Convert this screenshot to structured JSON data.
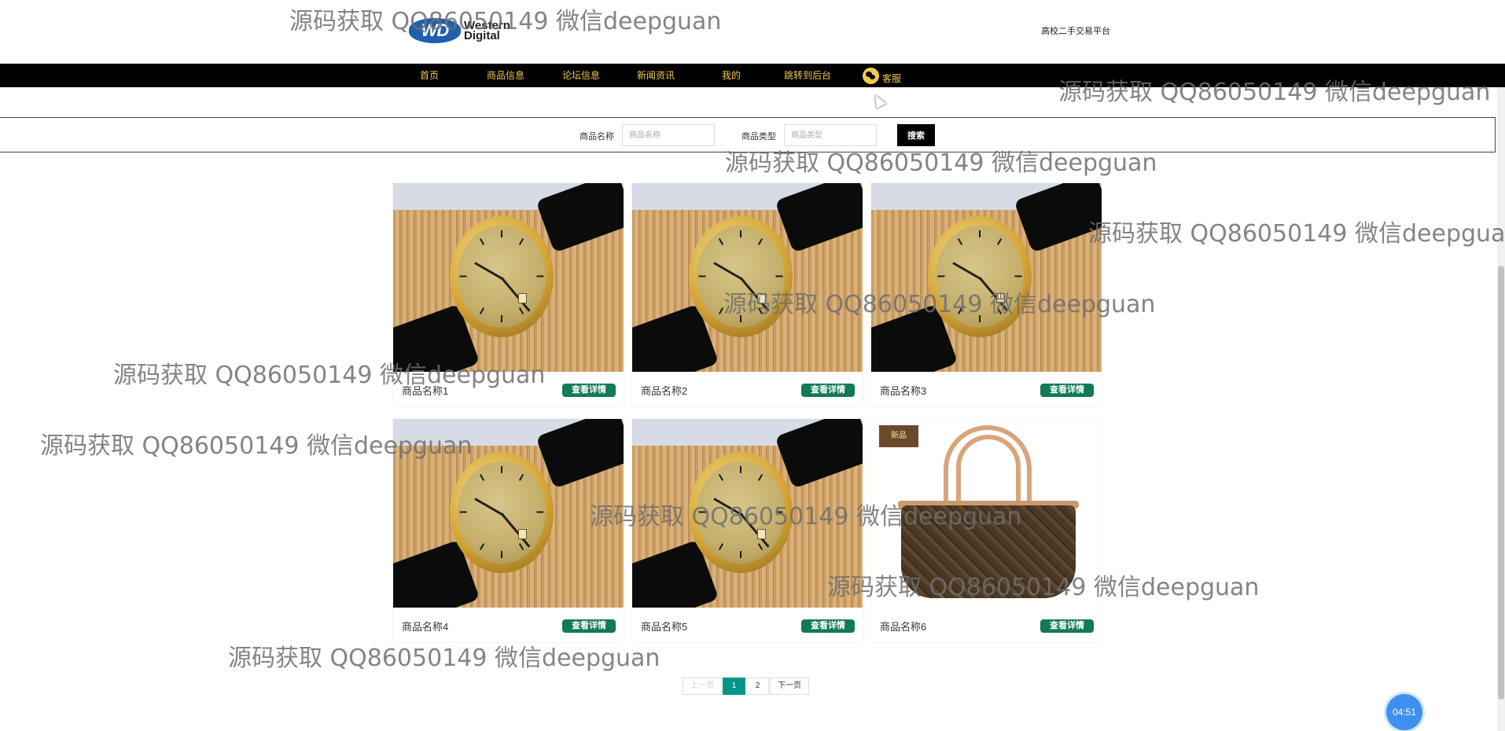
{
  "header": {
    "logo_text": "Western\nDigital",
    "logo_mark": "WD",
    "site_title": "高校二手交易平台"
  },
  "nav": {
    "items": [
      "首页",
      "商品信息",
      "论坛信息",
      "新闻资讯",
      "我的",
      "跳转到后台"
    ],
    "customer_service": "客服"
  },
  "search": {
    "name_label": "商品名称",
    "name_placeholder": "商品名称",
    "type_label": "商品类型",
    "type_placeholder": "商品类型",
    "button": "搜索"
  },
  "products": [
    {
      "name": "商品名称1",
      "button": "查看详情",
      "image": "watch"
    },
    {
      "name": "商品名称2",
      "button": "查看详情",
      "image": "watch"
    },
    {
      "name": "商品名称3",
      "button": "查看详情",
      "image": "watch"
    },
    {
      "name": "商品名称4",
      "button": "查看详情",
      "image": "watch"
    },
    {
      "name": "商品名称5",
      "button": "查看详情",
      "image": "watch"
    },
    {
      "name": "商品名称6",
      "button": "查看详情",
      "image": "handbag"
    }
  ],
  "pagination": {
    "prev": "上一页",
    "pages": [
      "1",
      "2"
    ],
    "current": "1",
    "next": "下一页"
  },
  "timer": "04:51",
  "watermark": "源码获取 QQ86050149 微信deepguan",
  "colors": {
    "nav_bg": "#000000",
    "nav_text": "#f2c94c",
    "detail_button": "#127a55",
    "pager_active": "#009688",
    "timer_bg": "#3f8ff0"
  }
}
